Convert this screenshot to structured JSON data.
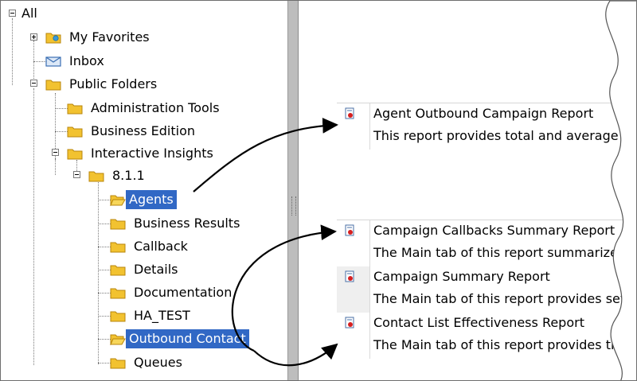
{
  "tree": {
    "root": "All",
    "my_favorites": "My Favorites",
    "inbox": "Inbox",
    "public_folders": "Public Folders",
    "administration_tools": "Administration Tools",
    "business_edition": "Business Edition",
    "interactive_insights": "Interactive Insights",
    "version": "8.1.1",
    "children": [
      {
        "label": "Agents",
        "selected": true
      },
      {
        "label": "Business Results",
        "selected": false
      },
      {
        "label": "Callback",
        "selected": false
      },
      {
        "label": "Details",
        "selected": false
      },
      {
        "label": "Documentation",
        "selected": false
      },
      {
        "label": "HA_TEST",
        "selected": false
      },
      {
        "label": "Outbound Contact",
        "selected": true
      },
      {
        "label": "Queues",
        "selected": false
      }
    ]
  },
  "reports": {
    "agents_group": [
      {
        "title": "Agent Outbound Campaign Report",
        "description": "This report provides total and average"
      }
    ],
    "outbound_group": [
      {
        "title": "Campaign Callbacks Summary Report",
        "description": "The Main tab of this report summarizes the"
      },
      {
        "title": "Campaign Summary Report",
        "description": "The Main tab of this report provides sev"
      },
      {
        "title": "Contact List Effectiveness Report",
        "description": "The Main tab of this report provides th"
      }
    ]
  },
  "colors": {
    "selection": "#3168c5",
    "folder": "#f2c230",
    "splitter": "#bdbdbd"
  }
}
